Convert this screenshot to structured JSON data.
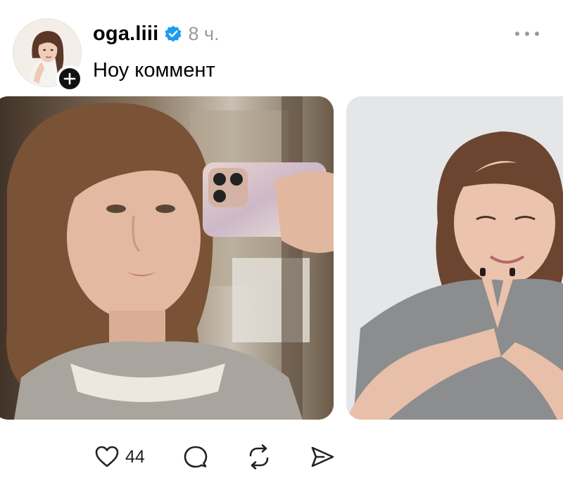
{
  "post": {
    "author": {
      "username": "oga.liii",
      "verified": true
    },
    "timestamp": "8 ч.",
    "caption": "Ноу коммент",
    "media_count": 2,
    "actions": {
      "like_count": "44"
    },
    "icons": {
      "follow": "plus-icon",
      "verified": "verified-badge-icon",
      "more": "more-horizontal-icon",
      "like": "heart-icon",
      "comment": "comment-icon",
      "repost": "repost-icon",
      "share": "send-icon"
    },
    "colors": {
      "verified": "#1d9bf0",
      "muted": "#9a9a9a",
      "text": "#000000"
    }
  }
}
